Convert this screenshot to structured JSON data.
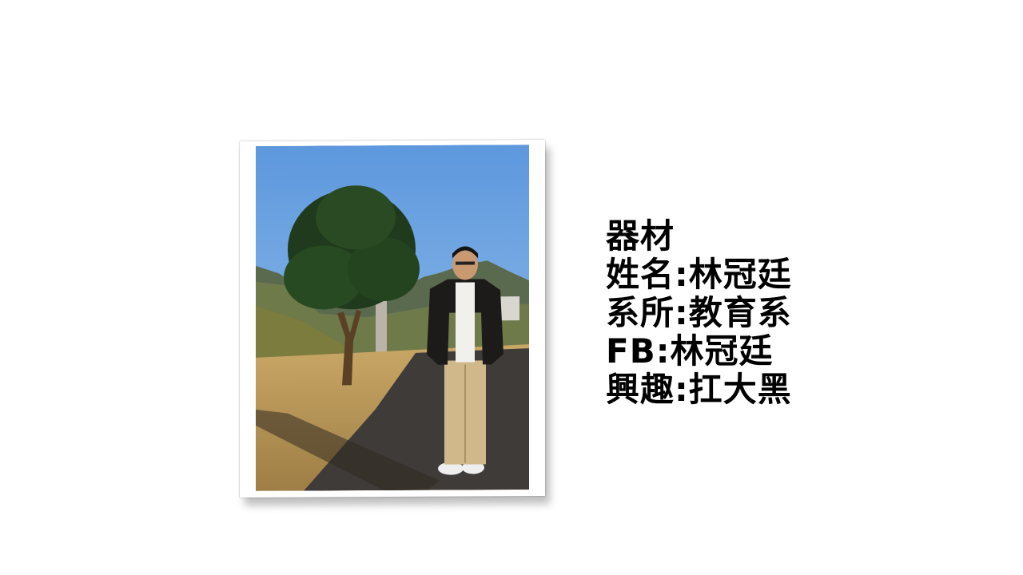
{
  "slide": {
    "lines": [
      "器材",
      "姓名:林冠廷",
      "系所:教育系",
      "FB:林冠廷",
      "興趣:扛大黑"
    ]
  },
  "colors": {
    "background": "#ffffff",
    "text": "#000000",
    "sky": "#6ea6e6",
    "grass": "#b99a5c",
    "road": "#3f3d3c"
  }
}
